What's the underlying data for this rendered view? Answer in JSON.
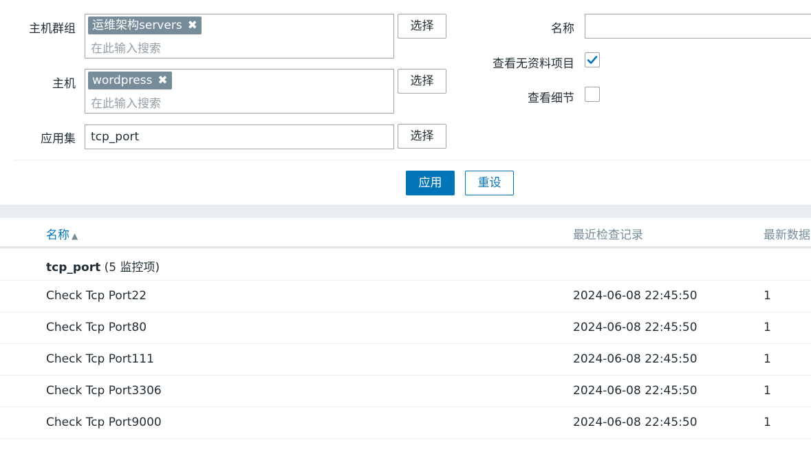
{
  "filter": {
    "host_group_label": "主机群组",
    "host_group_tag": "运维架构servers",
    "host_group_placeholder": "在此输入搜索",
    "host_label": "主机",
    "host_tag": "wordpress",
    "host_placeholder": "在此输入搜索",
    "app_label": "应用集",
    "app_value": "tcp_port",
    "select_label": "选择",
    "name_label": "名称",
    "name_value": "",
    "show_without_data_label": "查看无资料项目",
    "show_without_data_checked": true,
    "show_details_label": "查看细节",
    "show_details_checked": false,
    "apply_label": "应用",
    "reset_label": "重设"
  },
  "table": {
    "columns": [
      "名称",
      "最近检查记录",
      "最新数据"
    ],
    "sort_indicator": "▲",
    "group": {
      "name": "tcp_port",
      "count_text": "(5 监控项)"
    },
    "rows": [
      {
        "name": "Check Tcp Port22",
        "last_check": "2024-06-08 22:45:50",
        "last_value": "1"
      },
      {
        "name": "Check Tcp Port80",
        "last_check": "2024-06-08 22:45:50",
        "last_value": "1"
      },
      {
        "name": "Check Tcp Port111",
        "last_check": "2024-06-08 22:45:50",
        "last_value": "1"
      },
      {
        "name": "Check Tcp Port3306",
        "last_check": "2024-06-08 22:45:50",
        "last_value": "1"
      },
      {
        "name": "Check Tcp Port9000",
        "last_check": "2024-06-08 22:45:50",
        "last_value": "1"
      }
    ]
  },
  "colors": {
    "accent": "#0275b8",
    "tag_bg": "#768d99",
    "muted": "#768d99"
  },
  "icons": {
    "remove": "close-icon",
    "check": "checkmark-icon",
    "sort": "sort-ascending-icon"
  }
}
